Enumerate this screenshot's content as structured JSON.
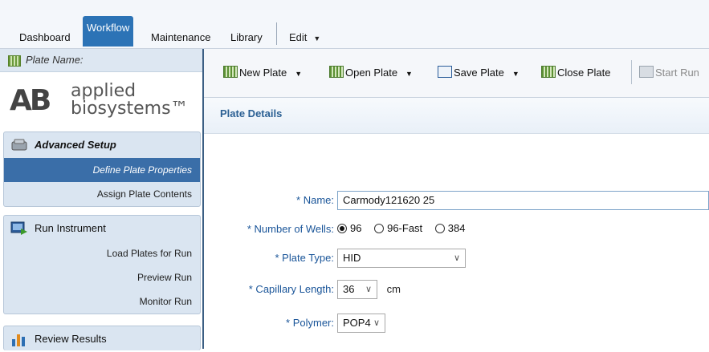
{
  "menu": {
    "tabs": [
      "Dashboard",
      "Workflow",
      "Maintenance",
      "Library"
    ],
    "edit": "Edit",
    "active_tab": "Workflow"
  },
  "left": {
    "plate_name_label": "Plate Name:",
    "logo": {
      "mark": "AB",
      "line1": "applied",
      "line2": "biosystems™"
    },
    "sections": [
      {
        "title": "Advanced Setup",
        "icon": "setup-icon",
        "items": [
          "Define Plate Properties",
          "Assign Plate Contents"
        ],
        "selected": "Define Plate Properties"
      },
      {
        "title": "Run Instrument",
        "icon": "instrument-icon",
        "items": [
          "Load Plates for Run",
          "Preview Run",
          "Monitor Run"
        ]
      },
      {
        "title": "Review Results",
        "icon": "bar-chart-icon",
        "items": []
      }
    ]
  },
  "toolbar": {
    "new_plate": "New Plate",
    "open_plate": "Open Plate",
    "save_plate": "Save Plate",
    "close_plate": "Close Plate",
    "start_run": "Start Run"
  },
  "details": {
    "title": "Plate Details",
    "name_label": "* Name:",
    "name_value": "Carmody121620 25",
    "wells_label": "* Number of Wells:",
    "wells_options": [
      "96",
      "96-Fast",
      "384"
    ],
    "wells_selected": "96",
    "plate_type_label": "* Plate Type:",
    "plate_type_value": "HID",
    "capillary_label": "* Capillary Length:",
    "capillary_value": "36",
    "capillary_unit": "cm",
    "polymer_label": "* Polymer:",
    "polymer_value": "POP4"
  }
}
